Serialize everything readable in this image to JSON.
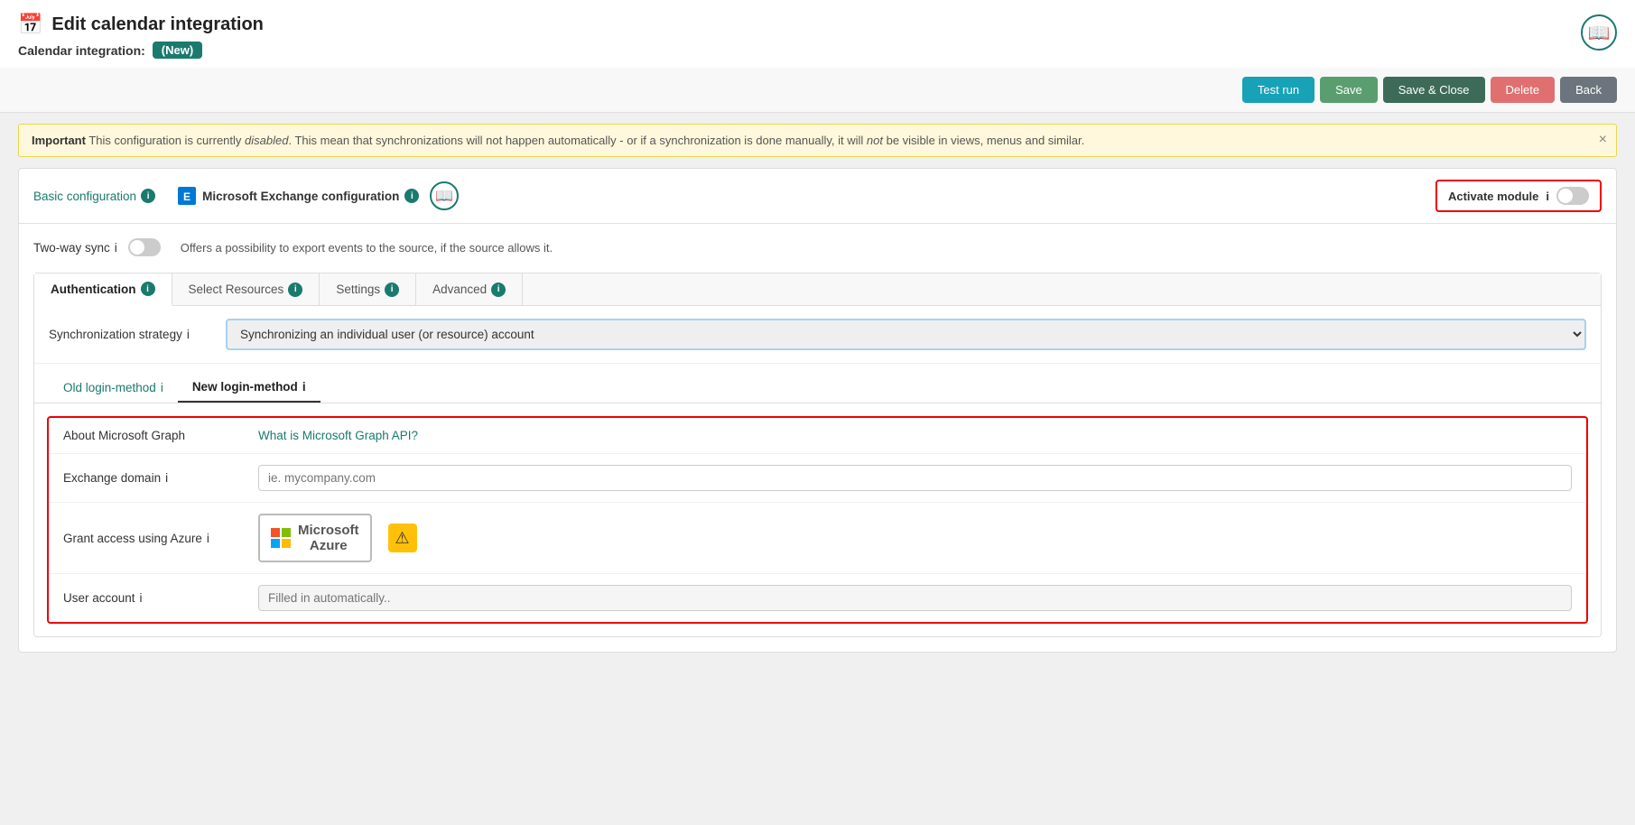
{
  "header": {
    "icon": "📅",
    "title": "Edit calendar integration",
    "subtitle_label": "Calendar integration:",
    "badge": "(New)",
    "logo": "📖"
  },
  "toolbar": {
    "test_run": "Test run",
    "save": "Save",
    "save_close": "Save & Close",
    "delete": "Delete",
    "back": "Back"
  },
  "banner": {
    "prefix_bold": "Important",
    "text_before": " This configuration is currently ",
    "italic1": "disabled",
    "text_middle": ". This mean that synchronizations will not happen automatically - or if a synchronization is done manually, it will ",
    "italic2": "not",
    "text_after": " be visible in views, menus and similar."
  },
  "config_tabs": {
    "basic": "Basic configuration",
    "exchange": "Microsoft Exchange configuration",
    "activate_module": "Activate module"
  },
  "two_way_sync": {
    "label": "Two-way sync",
    "note": "Offers a possibility to export events to the source, if the source allows it."
  },
  "sub_tabs": {
    "authentication": "Authentication",
    "select_resources": "Select Resources",
    "settings": "Settings",
    "advanced": "Advanced"
  },
  "strategy": {
    "label": "Synchronization strategy",
    "value": "Synchronizing an individual user (or resource) account"
  },
  "login_tabs": {
    "old": "Old login-method",
    "new": "New login-method"
  },
  "form": {
    "about_label": "About Microsoft Graph",
    "about_value": "What is Microsoft Graph API?",
    "domain_label": "Exchange domain",
    "domain_placeholder": "ie. mycompany.com",
    "grant_label": "Grant access using Azure",
    "azure_button": "Microsoft\nAzure",
    "user_label": "User account",
    "user_placeholder": "Filled in automatically.."
  },
  "info_icon_text": "i"
}
